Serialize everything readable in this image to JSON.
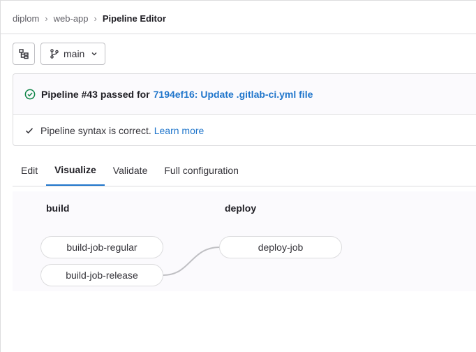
{
  "breadcrumb": {
    "items": [
      "diplom",
      "web-app"
    ],
    "current": "Pipeline Editor"
  },
  "toolbar": {
    "file_tree_icon": "file-tree-icon",
    "branch_icon": "git-branch-icon",
    "branch": "main"
  },
  "pipeline_status": {
    "title": "Pipeline #43 passed for",
    "commit_link": "7194ef16: Update .gitlab-ci.yml file",
    "status_icon": "status-success-icon"
  },
  "validation": {
    "message": "Pipeline syntax is correct.",
    "learn_more": "Learn more"
  },
  "tabs": [
    {
      "label": "Edit",
      "active": false
    },
    {
      "label": "Visualize",
      "active": true
    },
    {
      "label": "Validate",
      "active": false
    },
    {
      "label": "Full configuration",
      "active": false
    }
  ],
  "graph": {
    "stages": [
      {
        "name": "build",
        "jobs": [
          "build-job-regular",
          "build-job-release"
        ]
      },
      {
        "name": "deploy",
        "jobs": [
          "deploy-job"
        ]
      }
    ]
  },
  "colors": {
    "link": "#1f75cb",
    "success": "#108548",
    "tab_active": "#1f75cb"
  }
}
